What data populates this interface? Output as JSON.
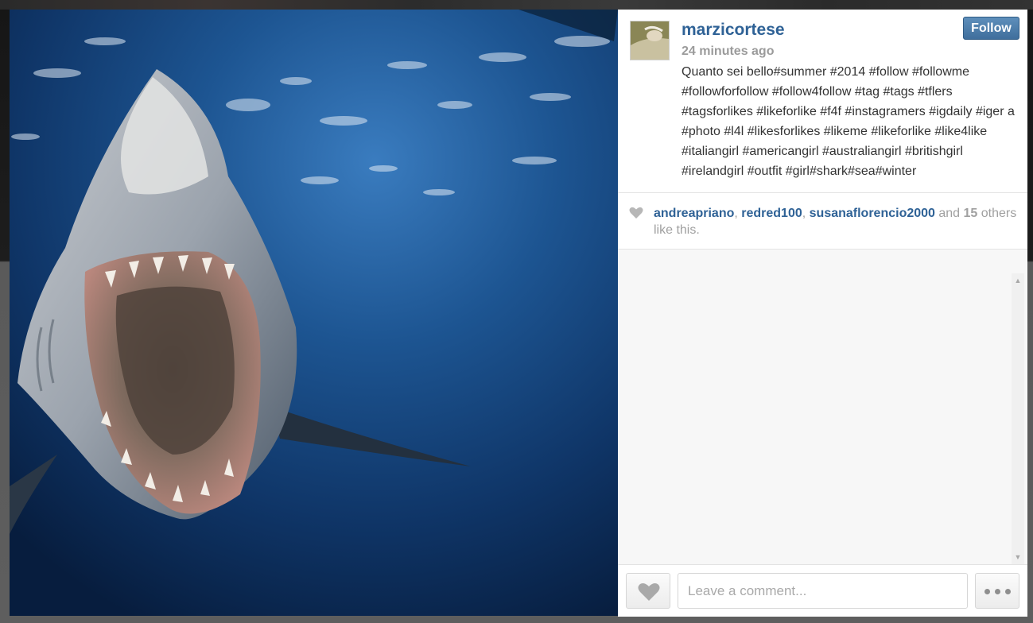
{
  "post": {
    "username": "marzicortese",
    "timestamp": "24 minutes ago",
    "caption": "Quanto sei bello#summer #2014 #follow #followme #followforfollow #follow4follow #tag #tags #tflers #tagsforlikes #likeforlike #f4f #instagramers #igdaily #iger a #photo #l4l #likesforlikes #likeme #likeforlike #like4like #italiangirl #americangirl #australiangirl #britishgirl #irelandgirl #outfit #girl#shark#sea#winter",
    "follow_label": "Follow"
  },
  "likes": {
    "likers": [
      "andreapriano",
      "redred100",
      "susanaflorencio2000"
    ],
    "separator": ", ",
    "and_text": " and ",
    "others_count": "15",
    "others_text": " others like this."
  },
  "comment_box": {
    "placeholder": "Leave a comment..."
  },
  "icons": {
    "like_small": "heart-icon",
    "like_button": "heart-icon",
    "more_button": "ellipsis-icon"
  },
  "colors": {
    "link": "#2f6296",
    "follow_button": "#4a7aa8",
    "muted_text": "#9b9b9b"
  }
}
